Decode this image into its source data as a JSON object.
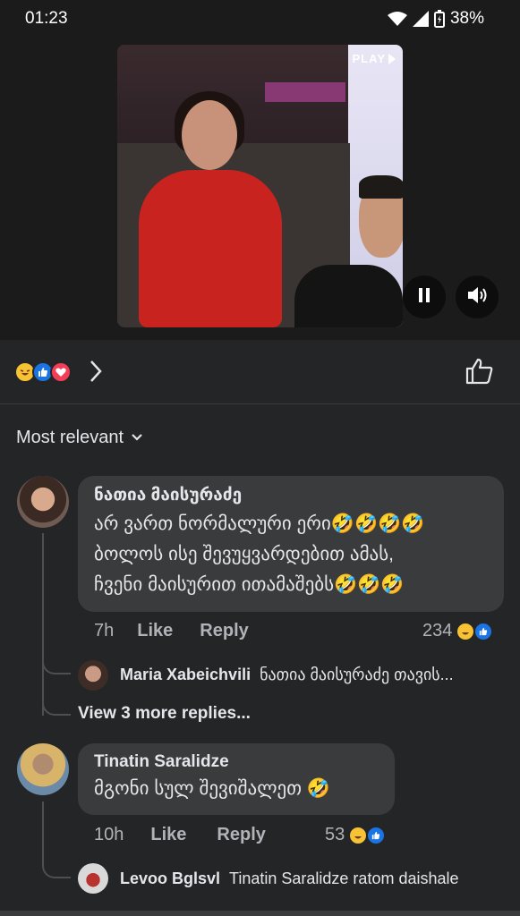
{
  "status": {
    "time": "01:23",
    "battery": "38%"
  },
  "video": {
    "play_badge": "PLAY"
  },
  "filter": {
    "label": "Most relevant"
  },
  "comments": [
    {
      "author": "ნათია მაისურაძე",
      "lines": [
        "არ ვართ ნორმალური ერი🤣🤣🤣🤣",
        "ბოლოს ისე შევუყვარდებით  ამას,",
        "ჩვენი მაისურით ითამაშებს🤣🤣🤣"
      ],
      "time": "7h",
      "like_label": "Like",
      "reply_label": "Reply",
      "reaction_count": "234",
      "reply": {
        "author": "Maria Xabeichvili",
        "text": "ნათია მაისურაძე  თავის..."
      },
      "view_more": "View 3 more replies..."
    },
    {
      "author": "Tinatin Saralidze",
      "lines": [
        "მგონი სულ შევიშალეთ 🤣"
      ],
      "time": "10h",
      "like_label": "Like",
      "reply_label": "Reply",
      "reaction_count": "53",
      "reply": {
        "author": "Levoo Bglsvl",
        "text": "Tinatin Saralidze ratom daishale"
      }
    }
  ],
  "colors": {
    "background": "#242526",
    "bubble": "#3a3b3c",
    "like_blue": "#1b74e4",
    "love_red": "#f33e58",
    "haha_yellow": "#f7c233"
  }
}
